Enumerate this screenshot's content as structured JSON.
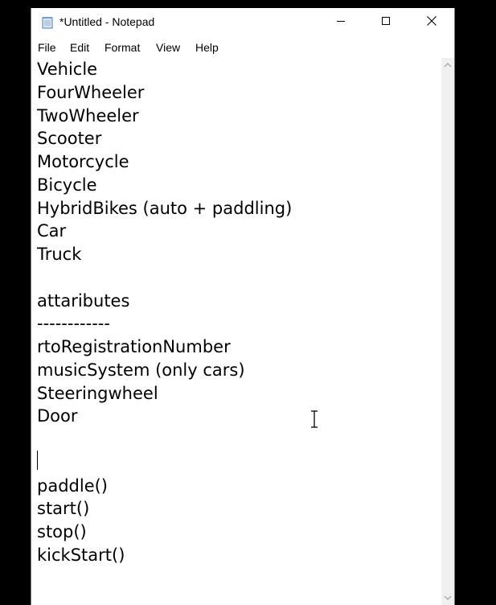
{
  "window": {
    "title": "*Untitled - Notepad",
    "icon": "notepad-icon",
    "controls": {
      "minimize": "minimize-icon",
      "maximize": "maximize-icon",
      "close": "close-icon"
    }
  },
  "menu": {
    "items": [
      "File",
      "Edit",
      "Format",
      "View",
      "Help"
    ]
  },
  "editor": {
    "lines": [
      "Vehicle",
      "FourWheeler",
      "TwoWheeler",
      "Scooter",
      "Motorcycle",
      "Bicycle",
      "HybridBikes (auto + paddling)",
      "Car",
      "Truck",
      "",
      "attaributes",
      "------------",
      "rtoRegistrationNumber",
      "musicSystem (only cars)",
      "Steeringwheel",
      "Door",
      "",
      "",
      "paddle()",
      "start()",
      "stop()",
      "kickStart()"
    ]
  },
  "colors": {
    "background": "#000000",
    "window": "#ffffff",
    "scrollbar": "#f0f0f0",
    "text": "#000000"
  }
}
